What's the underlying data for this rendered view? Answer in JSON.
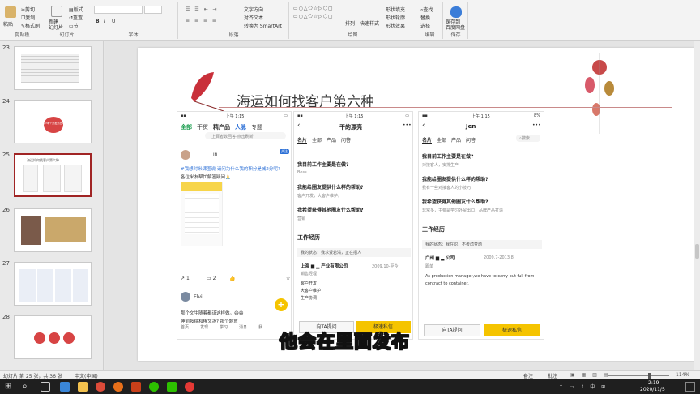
{
  "ribbon": {
    "clipboard": {
      "paste": "粘贴",
      "cut": "剪切",
      "copy": "复制",
      "format_painter": "格式刷",
      "label": "剪贴板"
    },
    "slides": {
      "new_slide": "新建\n幻灯片",
      "layout": "版式",
      "reset": "重置",
      "section": "节",
      "label": "幻灯片"
    },
    "font": {
      "bold": "B",
      "italic": "I",
      "underline": "U",
      "label": "字体"
    },
    "paragraph": {
      "text_direction": "文字方向",
      "align_text": "对齐文本",
      "smartart": "转换为 SmartArt",
      "label": "段落"
    },
    "drawing": {
      "arrange": "排列",
      "quick_styles": "快速样式",
      "shape_fill": "形状填充",
      "shape_outline": "形状轮廓",
      "shape_effects": "形状效果",
      "label": "绘图"
    },
    "editing": {
      "find": "查找",
      "replace": "替换",
      "select": "选择",
      "label": "编辑"
    },
    "baidu": {
      "save_to": "保存到\n百度网盘",
      "label": "保存"
    }
  },
  "sidebar": {
    "slides": [
      {
        "num": "23",
        "title": ""
      },
      {
        "num": "24",
        "title": "原始客户单个开发方法 Part.3"
      },
      {
        "num": "25",
        "title": "海运如何找客户第六种"
      },
      {
        "num": "26",
        "title": ""
      },
      {
        "num": "27",
        "title": ""
      },
      {
        "num": "28",
        "title": ""
      }
    ]
  },
  "slide": {
    "title": "海运如何找客户第六种",
    "phone1": {
      "time": "上午 1:15",
      "nav": [
        "全部",
        "干货",
        "精产品",
        "人脉",
        "专题"
      ],
      "search": "上百者数回答·点击刷新",
      "user": "in",
      "follow": "关注",
      "post_text_1": "#我想对米课圈说 请问为什么我的积分是减2分呢?",
      "post_text_2": "各位米友帮忙解答疑问🙏",
      "likes": "1",
      "comments": "2",
      "second_user": "Elvi",
      "second_text": "那个文生随着都该这样做。😄😄",
      "second_text_2": "睡前按续和稀文冰? 那个题意",
      "bottom_nav": [
        "首页",
        "发现",
        "学习",
        "消息",
        "我"
      ]
    },
    "phone2": {
      "time": "上午 1:15",
      "title": "干的漂亮",
      "tabs": [
        "名片",
        "全部",
        "产品",
        "问答"
      ],
      "q1": "我目前工作主要是在做?",
      "a1": "Boss",
      "q2": "我能给圈友提供什么样的帮助?",
      "a2": "客户开发，大客户维护。",
      "q3": "我希望获得其他圈友什么帮助?",
      "a3": "营销",
      "work_title": "工作经历",
      "work_status": "我的状态：我求贤若渴，正在招人",
      "company": "上海",
      "company_suffix": "产业有限公司",
      "date": "2009.10-至今",
      "role": "销售经理",
      "duties": [
        "客户开发",
        "大客户维护",
        "生产协调"
      ],
      "btn_ask": "向TA提问",
      "btn_msg": "极速私信"
    },
    "phone3": {
      "time": "上午 1:15",
      "battery": "8%",
      "title": "Jen",
      "tabs": [
        "名片",
        "全部",
        "产品",
        "问答"
      ],
      "search": "搜索",
      "q1": "我目前工作主要是在做?",
      "a1": "对接客人，安排生产",
      "q2": "我能给圈友提供什么样的帮助?",
      "a2": "我有一些对接客人的小技巧",
      "q3": "我希望获得其他圈友什么帮助?",
      "a3": "非常多，主要是学习外贸出口，品牌产品打造",
      "work_title": "工作经历",
      "work_status": "我的状态：我在职，不考虑变动",
      "company": "广州",
      "company_suffix": "公司",
      "date": "2009.7-2013.8",
      "role": "跟单",
      "desc_1": "As production manager,we have to carry out full from",
      "desc_2": "contract to container.",
      "btn_ask": "向TA提问",
      "btn_msg": "极速私信"
    }
  },
  "caption": "他会在里面发布",
  "statusbar": {
    "slide_info": "幻灯片 第 25 张，共 36 张",
    "language": "中文(中国)",
    "notes": "备注",
    "comments": "批注",
    "zoom": "114%"
  },
  "taskbar": {
    "time": "2:19",
    "date": "2020/11/5"
  }
}
